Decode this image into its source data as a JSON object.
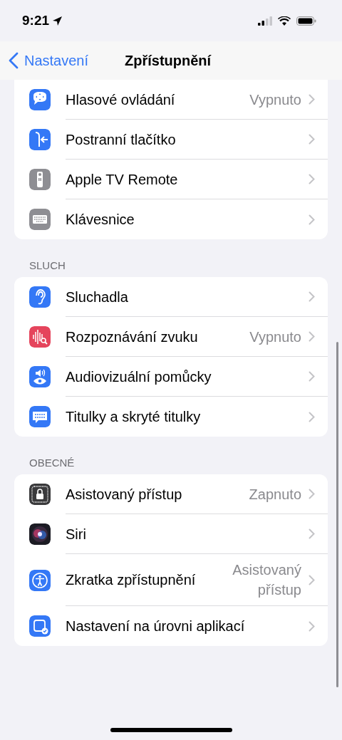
{
  "status_bar": {
    "time": "9:21"
  },
  "nav_bar": {
    "back": "Nastavení",
    "title": "Zpřístupnění"
  },
  "sections": [
    {
      "rows": [
        {
          "label": "Hlasové ovládání",
          "value": "Vypnuto"
        },
        {
          "label": "Postranní tlačítko"
        },
        {
          "label": "Apple TV Remote"
        },
        {
          "label": "Klávesnice"
        }
      ]
    },
    {
      "header": "SLUCH",
      "rows": [
        {
          "label": "Sluchadla"
        },
        {
          "label": "Rozpoznávání zvuku",
          "value": "Vypnuto"
        },
        {
          "label": "Audiovizuální pomůcky"
        },
        {
          "label": "Titulky a skryté titulky"
        }
      ]
    },
    {
      "header": "OBECNÉ",
      "rows": [
        {
          "label": "Asistovaný přístup",
          "value": "Zapnuto"
        },
        {
          "label": "Siri"
        },
        {
          "label": "Zkratka zpřístupnění",
          "value": "Asistovaný přístup"
        },
        {
          "label": "Nastavení na úrovni aplikací"
        }
      ]
    }
  ]
}
